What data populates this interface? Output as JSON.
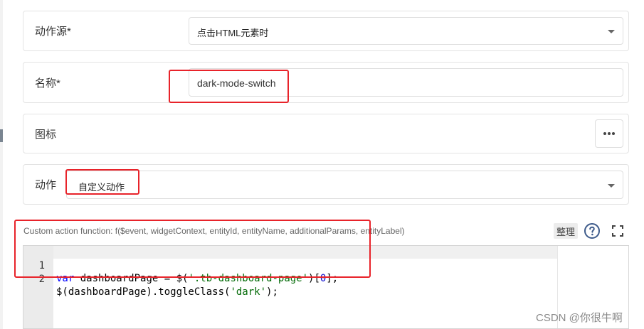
{
  "action_source": {
    "label": "动作源*",
    "value": "点击HTML元素时"
  },
  "name": {
    "label": "名称*",
    "value": "dark-mode-switch"
  },
  "icon": {
    "label": "图标",
    "more_button": "more-horizontal-icon"
  },
  "action": {
    "label": "动作",
    "value": "自定义动作"
  },
  "custom_function": {
    "hint": "Custom action function: f($event, widgetContext, entityId, entityName, additionalParams, entityLabel)",
    "tidy_button": "整理",
    "help_icon": "help-circle-icon",
    "fullscreen_icon": "fullscreen-icon"
  },
  "editor": {
    "lines": [
      {
        "no": "1",
        "kw": "var",
        "a": " dashboardPage = $(",
        "s1": "'.tb-dashboard-page'",
        "b": ")[",
        "n": "0",
        "c": "];"
      },
      {
        "no": "2",
        "a": "$(dashboardPage).toggleClass(",
        "s1": "'dark'",
        "c": ");"
      }
    ]
  },
  "watermark": "CSDN @你很牛啊",
  "colors": {
    "highlight": "#e8232a",
    "keyword": "#0000ff",
    "string": "#036a07"
  }
}
